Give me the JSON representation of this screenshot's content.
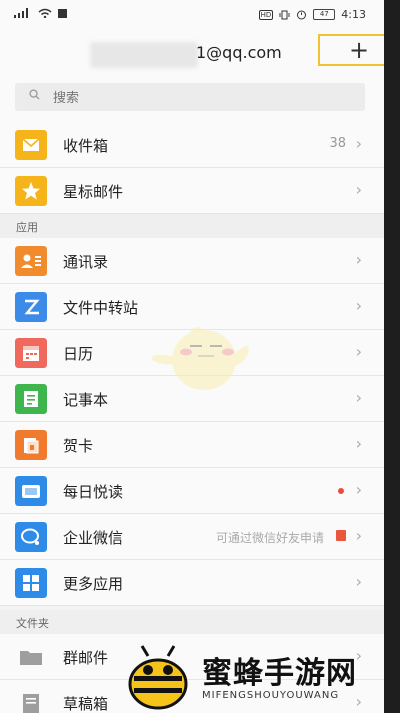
{
  "status_bar": {
    "time": "4:13",
    "hd": "HD",
    "battery": "47"
  },
  "header": {
    "account_email": "1@qq.com",
    "add_label": "+"
  },
  "search": {
    "placeholder": "搜索"
  },
  "mailboxes": [
    {
      "label": "收件箱",
      "count": "38",
      "icon": "inbox-icon",
      "color": "#f6b41b"
    },
    {
      "label": "星标邮件",
      "icon": "star-icon",
      "color": "#f6b41b"
    }
  ],
  "sections": {
    "apps": "应用",
    "folders": "文件夹"
  },
  "apps": [
    {
      "label": "通讯录",
      "icon": "contacts-icon",
      "color": "#f08c2e"
    },
    {
      "label": "文件中转站",
      "icon": "file-transfer-icon",
      "color": "#3d8be8"
    },
    {
      "label": "日历",
      "icon": "calendar-icon",
      "color": "#ef6a5d"
    },
    {
      "label": "记事本",
      "icon": "notepad-icon",
      "color": "#3fb54e"
    },
    {
      "label": "贺卡",
      "icon": "greeting-card-icon",
      "color": "#f07a2e"
    },
    {
      "label": "每日悦读",
      "icon": "daily-read-icon",
      "color": "#2e8ce8"
    },
    {
      "label": "企业微信",
      "hint": "可通过微信好友申请",
      "icon": "wecom-icon",
      "color": "#2e8ce8"
    },
    {
      "label": "更多应用",
      "icon": "more-apps-icon",
      "color": "#2e8ce8"
    }
  ],
  "folders": [
    {
      "label": "群邮件",
      "icon": "group-mail-icon",
      "color": "#9e9e9e"
    },
    {
      "label": "草稿箱",
      "icon": "drafts-icon",
      "color": "#9e9e9e"
    }
  ],
  "watermark": {
    "title": "蜜蜂手游网",
    "subtitle": "MIFENGSHOUYOUWANG"
  }
}
